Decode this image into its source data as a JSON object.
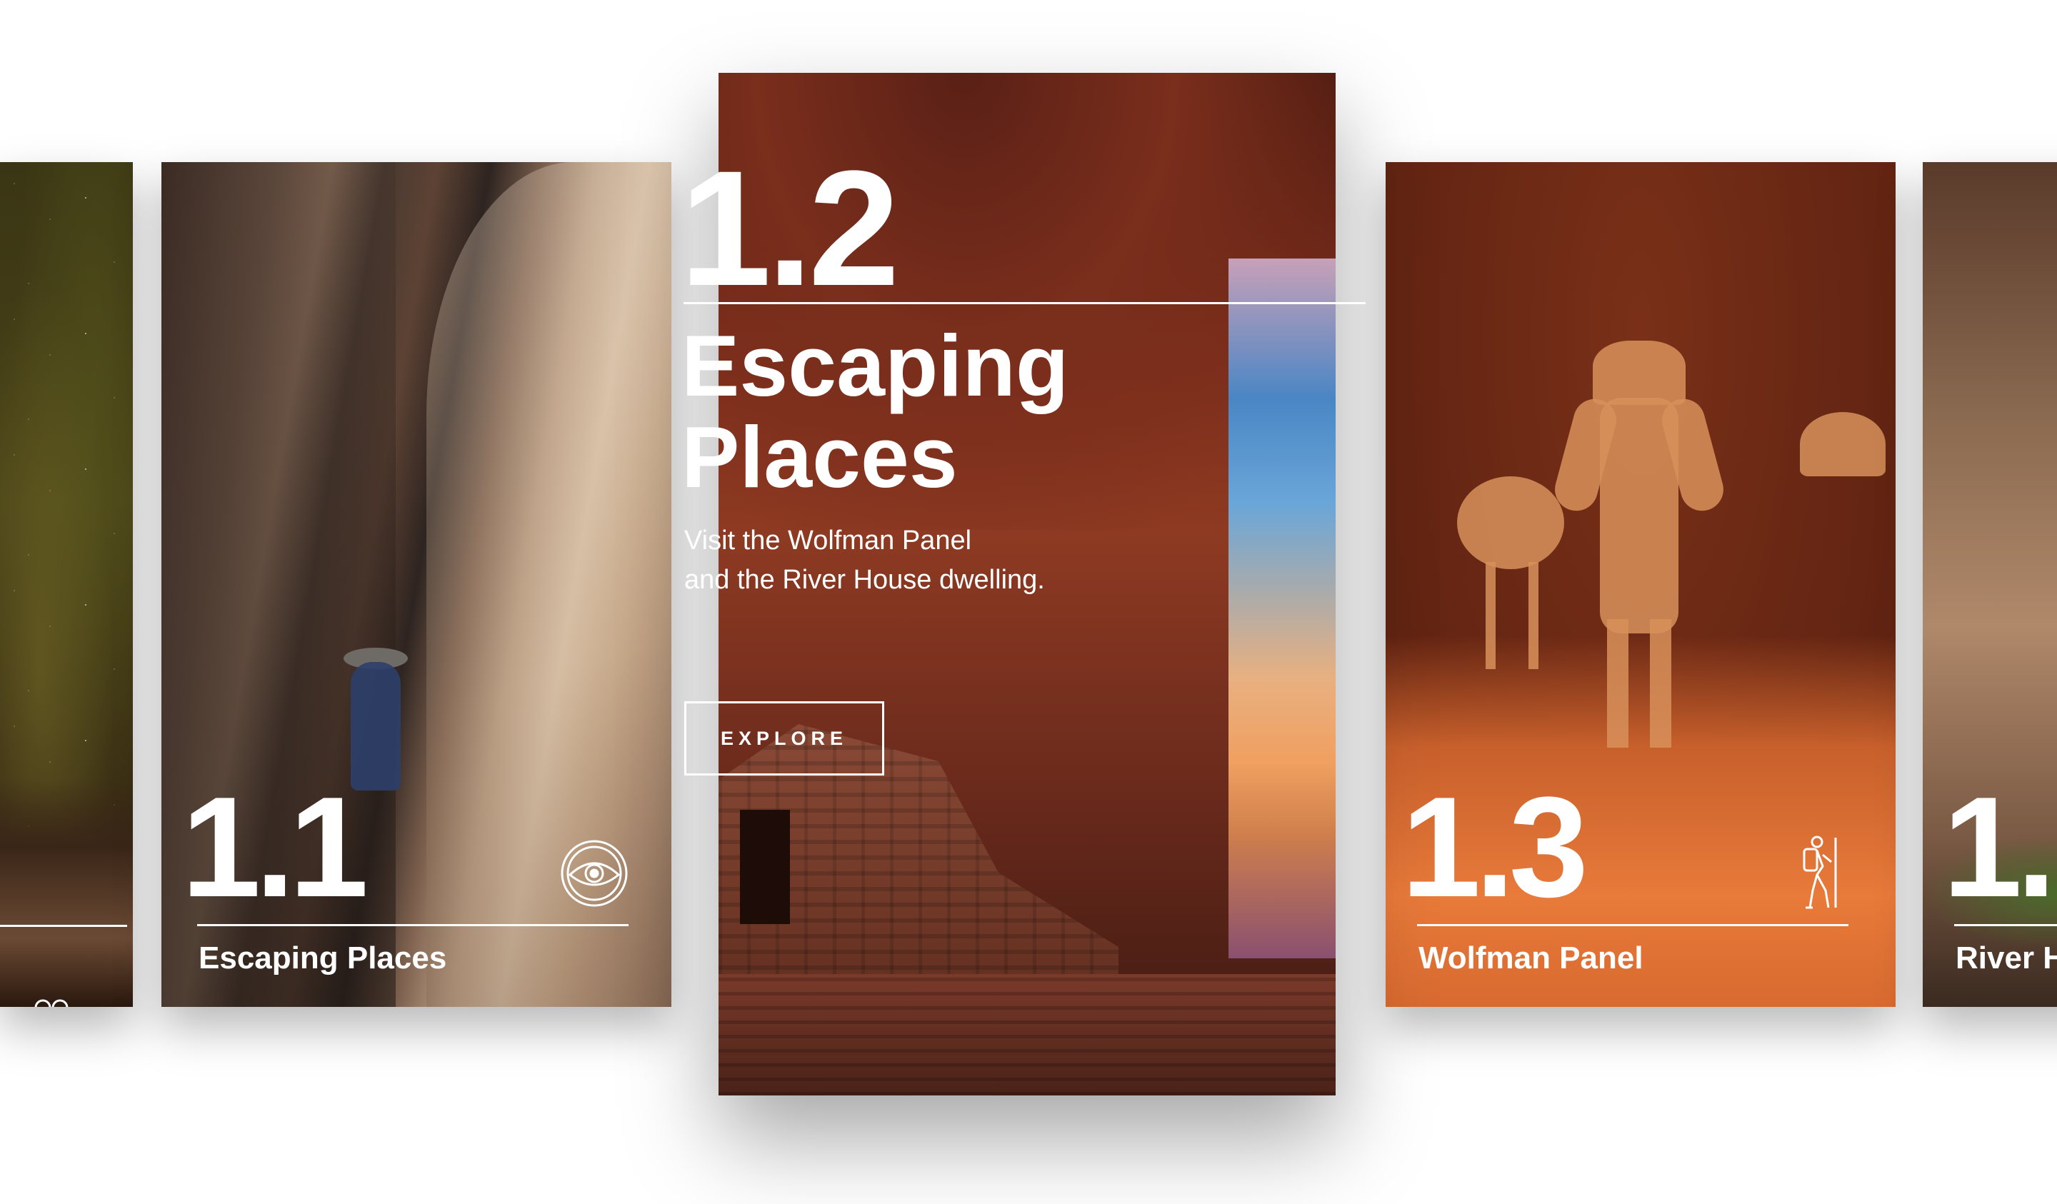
{
  "featured": {
    "number": "1.2",
    "title": "Escaping Places",
    "description": "Visit the Wolfman Panel\nand the River House dwelling.",
    "button_label": "EXPLORE"
  },
  "cards": [
    {
      "number": "",
      "title": "",
      "icon": "film-camera-icon"
    },
    {
      "number": "1.1",
      "title": "Escaping Places",
      "icon": "eye-icon"
    },
    {
      "number": "1.3",
      "title": "Wolfman Panel",
      "icon": "hiker-icon"
    },
    {
      "number": "1.",
      "title": "River H",
      "icon": ""
    }
  ],
  "colors": {
    "text": "#ffffff",
    "background": "#ffffff"
  }
}
